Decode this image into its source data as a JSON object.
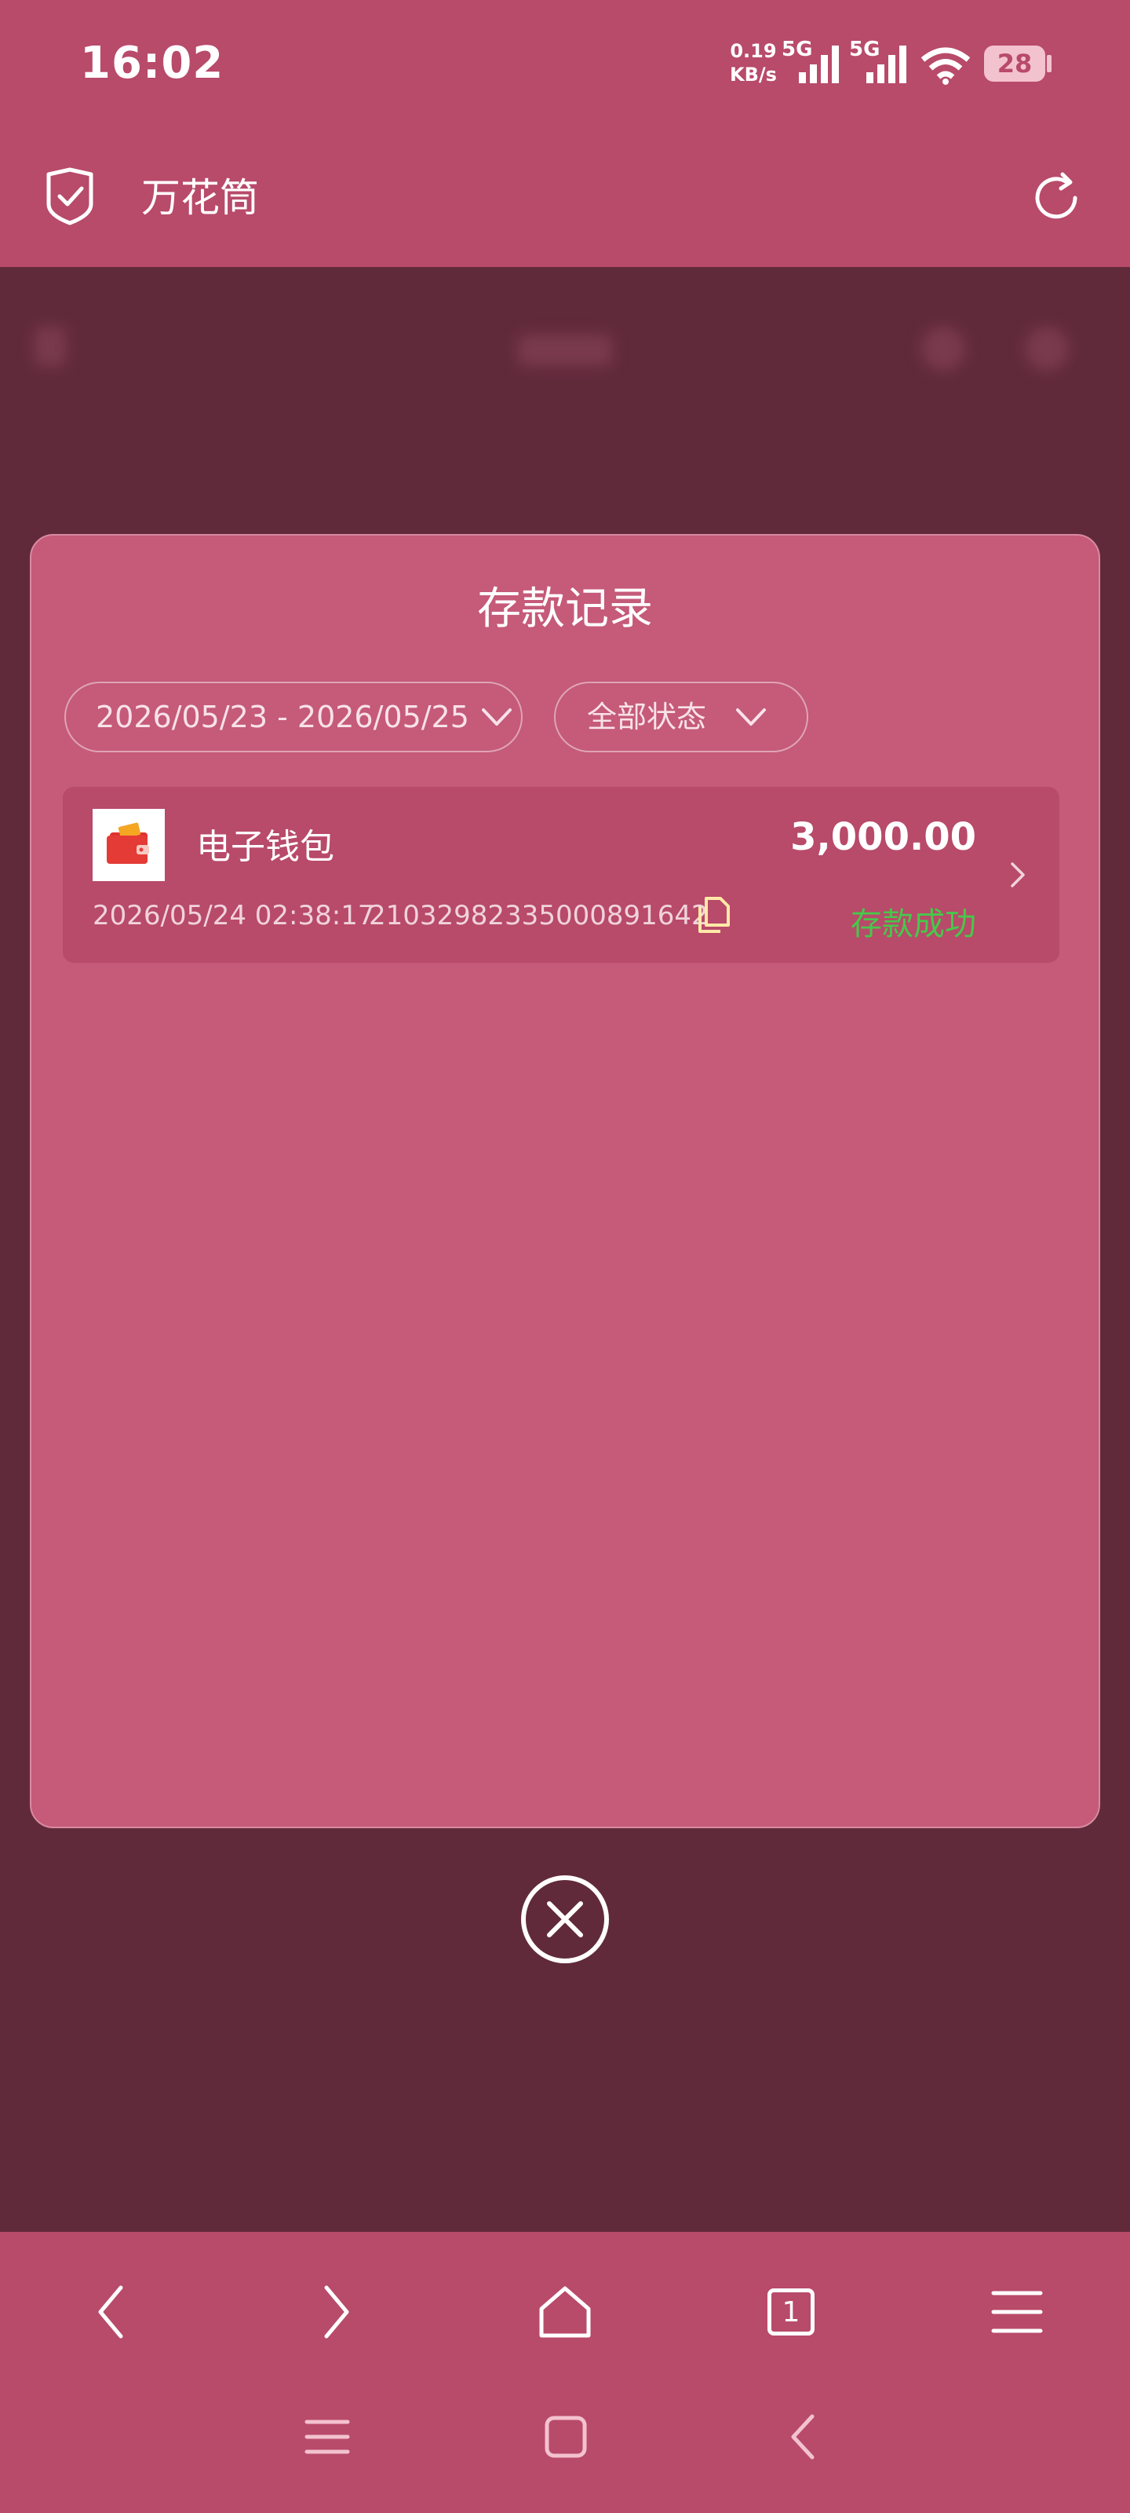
{
  "status_bar": {
    "time": "16:02",
    "net_speed_value": "0.19",
    "net_speed_unit": "KB/s",
    "signal1_label": "5G",
    "signal2_label": "5G",
    "battery": "28"
  },
  "browser_header": {
    "title": "万花筒"
  },
  "modal": {
    "title": "存款记录",
    "date_range": "2026/05/23 - 2026/05/25",
    "status_filter": "全部状态",
    "records": [
      {
        "name": "电子钱包",
        "amount": "3,000.00",
        "time": "2026/05/24 02:38:17",
        "order_id": "21032982335000891642",
        "status": "存款成功",
        "status_color": "#47c84a"
      }
    ]
  },
  "bottom_nav": {
    "tab_count": "1"
  },
  "colors": {
    "chrome": "#b84a6a",
    "overlay": "#612a3b",
    "modal": "#c55a79",
    "success": "#47c84a"
  }
}
